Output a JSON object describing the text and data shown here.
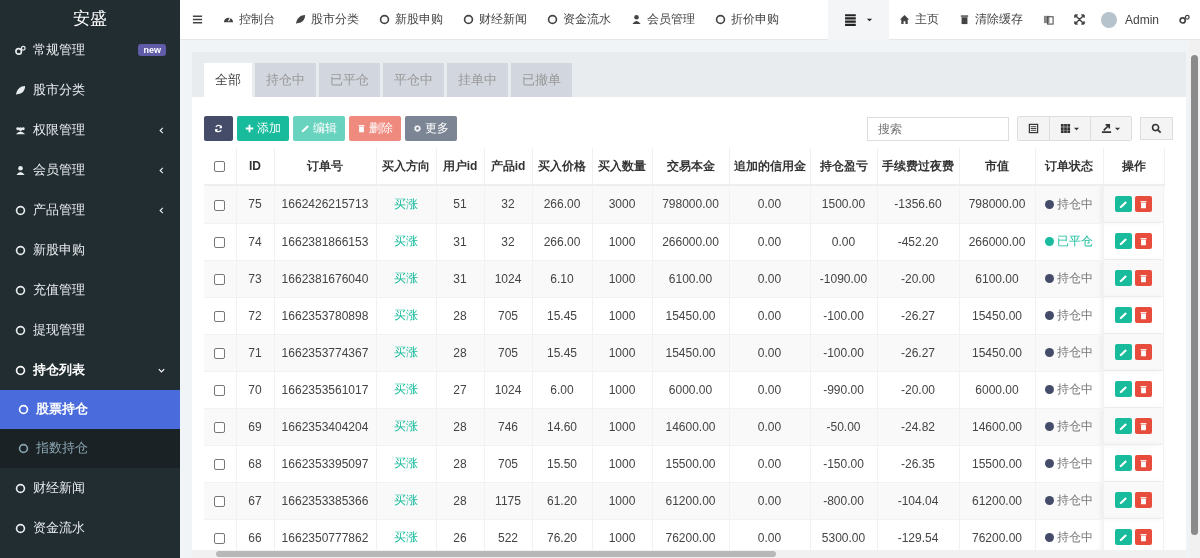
{
  "brand": "安盛",
  "sidebar": {
    "items": [
      {
        "label": "常规管理",
        "badge": "new",
        "selected": false
      },
      {
        "label": "股市分类",
        "selected": false
      },
      {
        "label": "权限管理",
        "expanded": false,
        "selected": false
      },
      {
        "label": "会员管理",
        "expanded": false,
        "selected": false
      },
      {
        "label": "产品管理",
        "expanded": false,
        "selected": false
      },
      {
        "label": "新股申购",
        "selected": false
      },
      {
        "label": "充值管理",
        "selected": false
      },
      {
        "label": "提现管理",
        "selected": false
      },
      {
        "label": "持仓列表",
        "expanded": true,
        "selected": false,
        "children": [
          {
            "label": "股票持仓",
            "selected": true
          },
          {
            "label": "指数持仓",
            "selected": false
          }
        ]
      },
      {
        "label": "财经新闻",
        "selected": false
      },
      {
        "label": "资金流水",
        "selected": false
      }
    ]
  },
  "topnav": {
    "items": [
      "控制台",
      "股市分类",
      "新股申购",
      "财经新闻",
      "资金流水",
      "会员管理",
      "折价申购"
    ],
    "right": [
      "主页",
      "清除缓存"
    ],
    "user": "Admin"
  },
  "tabs": [
    {
      "label": "全部",
      "selected": true
    },
    {
      "label": "持仓中",
      "selected": false
    },
    {
      "label": "已平仓",
      "selected": false
    },
    {
      "label": "平仓中",
      "selected": false
    },
    {
      "label": "挂单中",
      "selected": false
    },
    {
      "label": "已撤单",
      "selected": false
    }
  ],
  "toolbar": {
    "buttons": [
      {
        "kind": "refresh"
      },
      {
        "kind": "add",
        "label": "添加",
        "disabled": false
      },
      {
        "kind": "edit",
        "label": "编辑",
        "disabled": true
      },
      {
        "kind": "delete",
        "label": "删除",
        "disabled": true
      },
      {
        "kind": "more",
        "label": "更多",
        "disabled": false
      }
    ],
    "search": {
      "placeholder": "搜索"
    }
  },
  "table": {
    "select_all": {
      "checked": false
    },
    "columns": [
      "ID",
      "订单号",
      "买入方向",
      "用户id",
      "产品id",
      "买入价格",
      "买入数量",
      "交易本金",
      "追加的信用金",
      "持仓盈亏",
      "手续费过夜费",
      "市值",
      "订单状态",
      "操作"
    ],
    "rows": [
      {
        "checked": false,
        "cells": [
          "75",
          "1662426215713",
          "买涨",
          "51",
          "32",
          "266.00",
          "3000",
          "798000.00",
          "0.00",
          "1500.00",
          "-1356.60",
          "798000.00"
        ],
        "status": {
          "label": "持仓中",
          "kind": "open",
          "color": "#444c69"
        }
      },
      {
        "checked": false,
        "cells": [
          "74",
          "1662381866153",
          "买涨",
          "31",
          "32",
          "266.00",
          "1000",
          "266000.00",
          "0.00",
          "0.00",
          "-452.20",
          "266000.00"
        ],
        "status": {
          "label": "已平仓",
          "kind": "closed",
          "color": "#18bc9c"
        }
      },
      {
        "checked": false,
        "cells": [
          "73",
          "1662381676040",
          "买涨",
          "31",
          "1024",
          "6.10",
          "1000",
          "6100.00",
          "0.00",
          "-1090.00",
          "-20.00",
          "6100.00"
        ],
        "status": {
          "label": "持仓中",
          "kind": "open",
          "color": "#444c69"
        }
      },
      {
        "checked": false,
        "cells": [
          "72",
          "1662353780898",
          "买涨",
          "28",
          "705",
          "15.45",
          "1000",
          "15450.00",
          "0.00",
          "-100.00",
          "-26.27",
          "15450.00"
        ],
        "status": {
          "label": "持仓中",
          "kind": "open",
          "color": "#444c69"
        }
      },
      {
        "checked": false,
        "cells": [
          "71",
          "1662353774367",
          "买涨",
          "28",
          "705",
          "15.45",
          "1000",
          "15450.00",
          "0.00",
          "-100.00",
          "-26.27",
          "15450.00"
        ],
        "status": {
          "label": "持仓中",
          "kind": "open",
          "color": "#444c69"
        }
      },
      {
        "checked": false,
        "cells": [
          "70",
          "1662353561017",
          "买涨",
          "27",
          "1024",
          "6.00",
          "1000",
          "6000.00",
          "0.00",
          "-990.00",
          "-20.00",
          "6000.00"
        ],
        "status": {
          "label": "持仓中",
          "kind": "open",
          "color": "#444c69"
        }
      },
      {
        "checked": false,
        "cells": [
          "69",
          "1662353404204",
          "买涨",
          "28",
          "746",
          "14.60",
          "1000",
          "14600.00",
          "0.00",
          "-50.00",
          "-24.82",
          "14600.00"
        ],
        "status": {
          "label": "持仓中",
          "kind": "open",
          "color": "#444c69"
        }
      },
      {
        "checked": false,
        "cells": [
          "68",
          "1662353395097",
          "买涨",
          "28",
          "705",
          "15.50",
          "1000",
          "15500.00",
          "0.00",
          "-150.00",
          "-26.35",
          "15500.00"
        ],
        "status": {
          "label": "持仓中",
          "kind": "open",
          "color": "#444c69"
        }
      },
      {
        "checked": false,
        "cells": [
          "67",
          "1662353385366",
          "买涨",
          "28",
          "1175",
          "61.20",
          "1000",
          "61200.00",
          "0.00",
          "-800.00",
          "-104.04",
          "61200.00"
        ],
        "status": {
          "label": "持仓中",
          "kind": "open",
          "color": "#444c69"
        }
      },
      {
        "checked": false,
        "cells": [
          "66",
          "1662350777862",
          "买涨",
          "26",
          "522",
          "76.20",
          "1000",
          "76200.00",
          "0.00",
          "5300.00",
          "-129.54",
          "76200.00"
        ],
        "status": {
          "label": "持仓中",
          "kind": "open",
          "color": "#444c69"
        }
      }
    ]
  }
}
